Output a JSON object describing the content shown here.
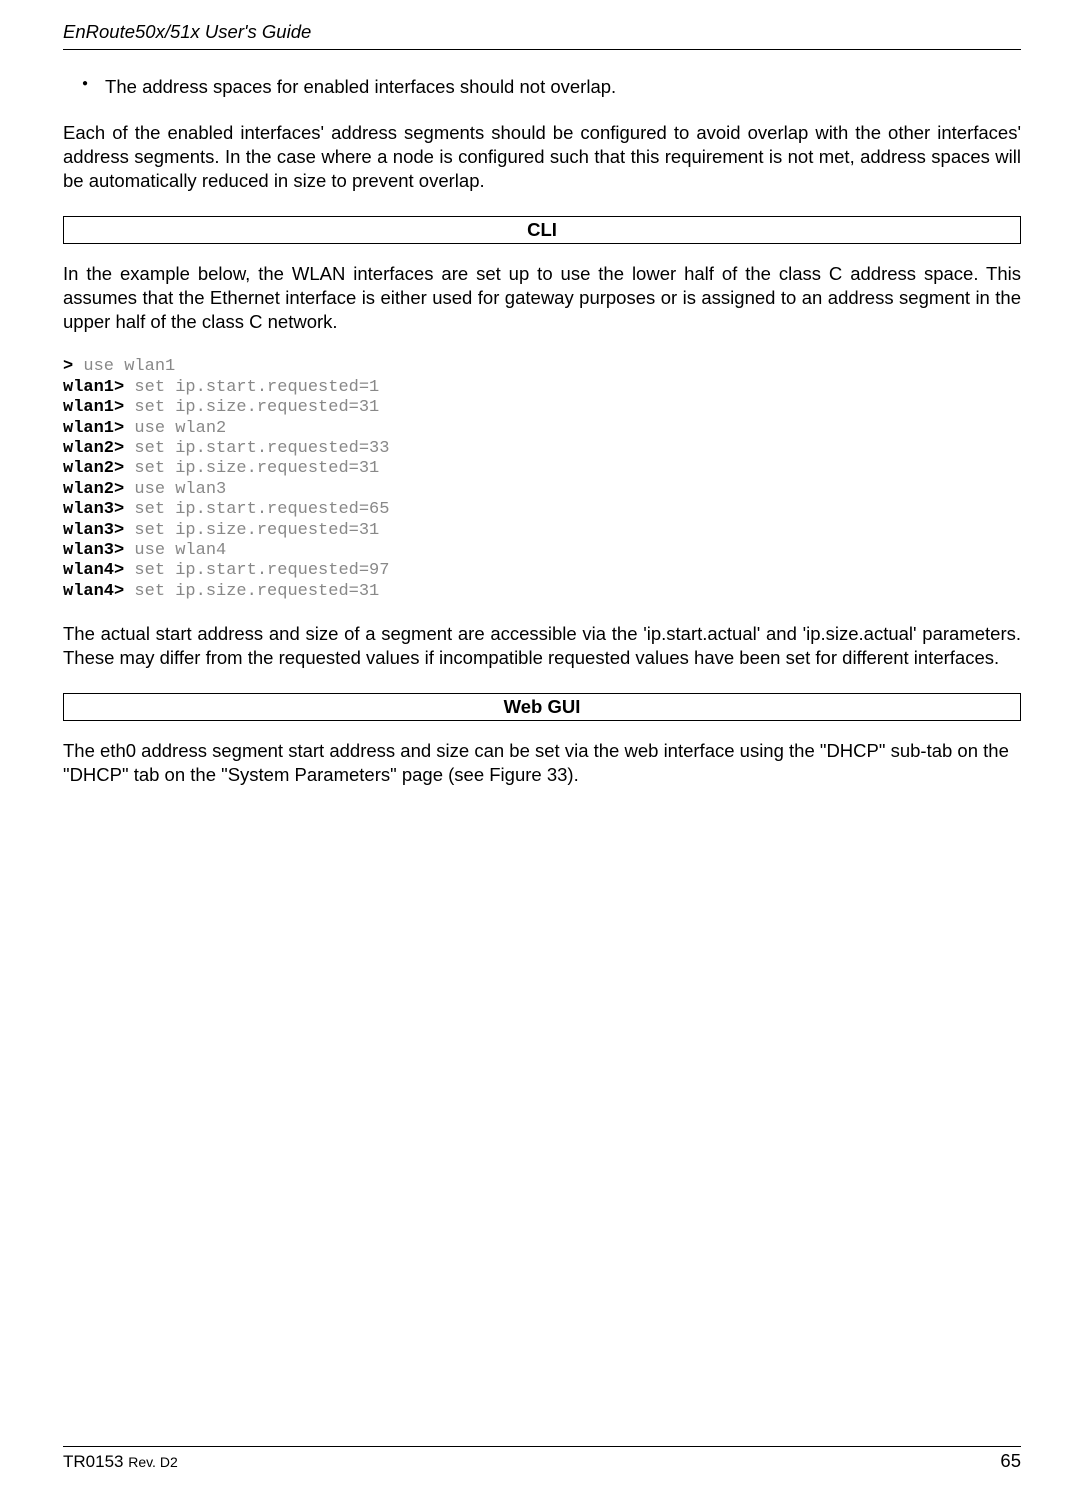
{
  "header": {
    "title": "EnRoute50x/51x User's Guide"
  },
  "bullet": {
    "text": "The address spaces for enabled interfaces should not overlap."
  },
  "para1": "Each of the enabled interfaces' address segments should be configured to avoid overlap with the other interfaces' address segments. In the case where a node is configured such that this requirement is not met, address spaces will be automatically reduced in size to prevent overlap.",
  "cli_header": "CLI",
  "para2": "In the example below, the WLAN interfaces are set up to use the lower half of the class C address space. This assumes that the Ethernet interface is either used for gateway purposes or is assigned to an address segment in the upper half of the class C network.",
  "code": {
    "lines": [
      {
        "prompt": ">",
        "cmd": " use wlan1"
      },
      {
        "prompt": "wlan1>",
        "cmd": " set ip.start.requested=1"
      },
      {
        "prompt": "wlan1>",
        "cmd": " set ip.size.requested=31"
      },
      {
        "prompt": "wlan1>",
        "cmd": " use wlan2"
      },
      {
        "prompt": "wlan2>",
        "cmd": " set ip.start.requested=33"
      },
      {
        "prompt": "wlan2>",
        "cmd": " set ip.size.requested=31"
      },
      {
        "prompt": "wlan2>",
        "cmd": " use wlan3"
      },
      {
        "prompt": "wlan3>",
        "cmd": " set ip.start.requested=65"
      },
      {
        "prompt": "wlan3>",
        "cmd": " set ip.size.requested=31"
      },
      {
        "prompt": "wlan3>",
        "cmd": " use wlan4"
      },
      {
        "prompt": "wlan4>",
        "cmd": " set ip.start.requested=97"
      },
      {
        "prompt": "wlan4>",
        "cmd": " set ip.size.requested=31"
      }
    ]
  },
  "para3": "The actual start address and size of a segment are accessible via the 'ip.start.actual' and 'ip.size.actual' parameters. These may differ from the requested values if incompatible requested values have been set for different interfaces.",
  "webgui_header": "Web GUI",
  "para4": "The eth0 address segment start address and size can be set via the web interface using the \"DHCP\" sub-tab on the \"DHCP\" tab on the \"System Parameters\" page (see Figure 33).",
  "footer": {
    "doc": "TR0153 ",
    "rev": "Rev. D2",
    "page": "65"
  }
}
